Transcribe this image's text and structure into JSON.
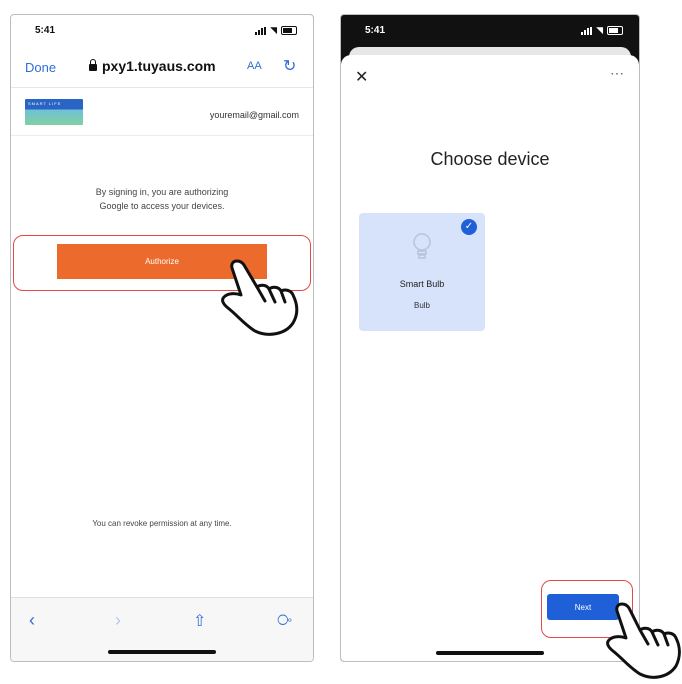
{
  "left_screen": {
    "status": {
      "time": "5:41"
    },
    "browser": {
      "done_label": "Done",
      "url": "pxy1.tuyaus.com",
      "text_size_label": "AA"
    },
    "account": {
      "logo_text": "SMART LIFE",
      "email": "youremail@gmail.com"
    },
    "signin_line1": "By signing in, you are authorizing",
    "signin_line2": "Google to access your devices.",
    "authorize_label": "Authorize",
    "revoke_text": "You can revoke permission at any time.",
    "toolbar_icons": [
      "back-icon",
      "forward-icon",
      "share-icon",
      "compass-icon"
    ]
  },
  "right_screen": {
    "status": {
      "time": "5:41"
    },
    "title": "Choose device",
    "device": {
      "name": "Smart Bulb",
      "type": "Bulb",
      "selected": true
    },
    "next_label": "Next"
  },
  "colors": {
    "authorize": "#ec6a2c",
    "next": "#1f5fd8",
    "highlight": "#e2494a",
    "link": "#2f6fd6",
    "card": "#d7e3fb"
  }
}
